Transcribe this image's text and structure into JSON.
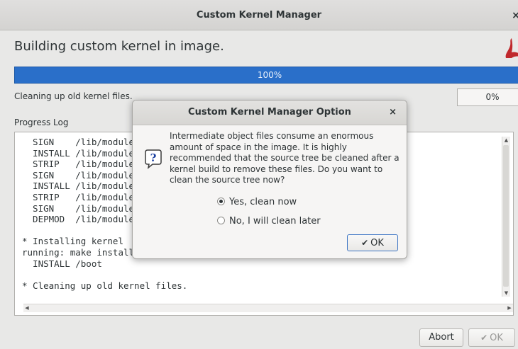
{
  "window": {
    "title": "Custom Kernel Manager",
    "close_glyph": "×"
  },
  "main": {
    "heading": "Building custom kernel in image.",
    "progress_label": "100%",
    "progress_value": 1.0,
    "status_text": "Cleaning up old kernel files.",
    "step_progress_label": "0%",
    "log_label": "Progress Log",
    "log_lines": [
      "  SIGN    /lib/modules/usb/usx2y/snd-us",
      "  INSTALL /lib/modules/virtio/virtio_sn",
      "  STRIP   /lib/modules/virtio/virtio_sn",
      "  SIGN    /lib/modules/virtio/virtio_sn",
      "  INSTALL /lib/modules/x86/snd-hdmi-lpe",
      "  STRIP   /lib/modules/x86/snd-hdmi-lpe",
      "  SIGN    /lib/modules/x86/snd-hdmi-lpe",
      "  DEPMOD  /lib/modules",
      "",
      "* Installing kernel",
      "running: make install",
      "  INSTALL /boot",
      "",
      "* Cleaning up old kernel files."
    ],
    "buttons": {
      "abort": "Abort",
      "ok": "OK"
    }
  },
  "dialog": {
    "title": "Custom Kernel Manager Option",
    "close_glyph": "×",
    "icon": "question-icon",
    "message": "Intermediate object files consume an enormous amount of space in the image.  It is highly recommended that the source tree be cleaned after a kernel build to remove these files.    Do you want to clean the source tree now?",
    "options": [
      {
        "label": "Yes, clean now",
        "selected": true
      },
      {
        "label": "No, I will clean later",
        "selected": false
      }
    ],
    "ok_label": "OK"
  },
  "colors": {
    "progress_fill": "#2a6fc9",
    "logo_red": "#c0282d"
  }
}
